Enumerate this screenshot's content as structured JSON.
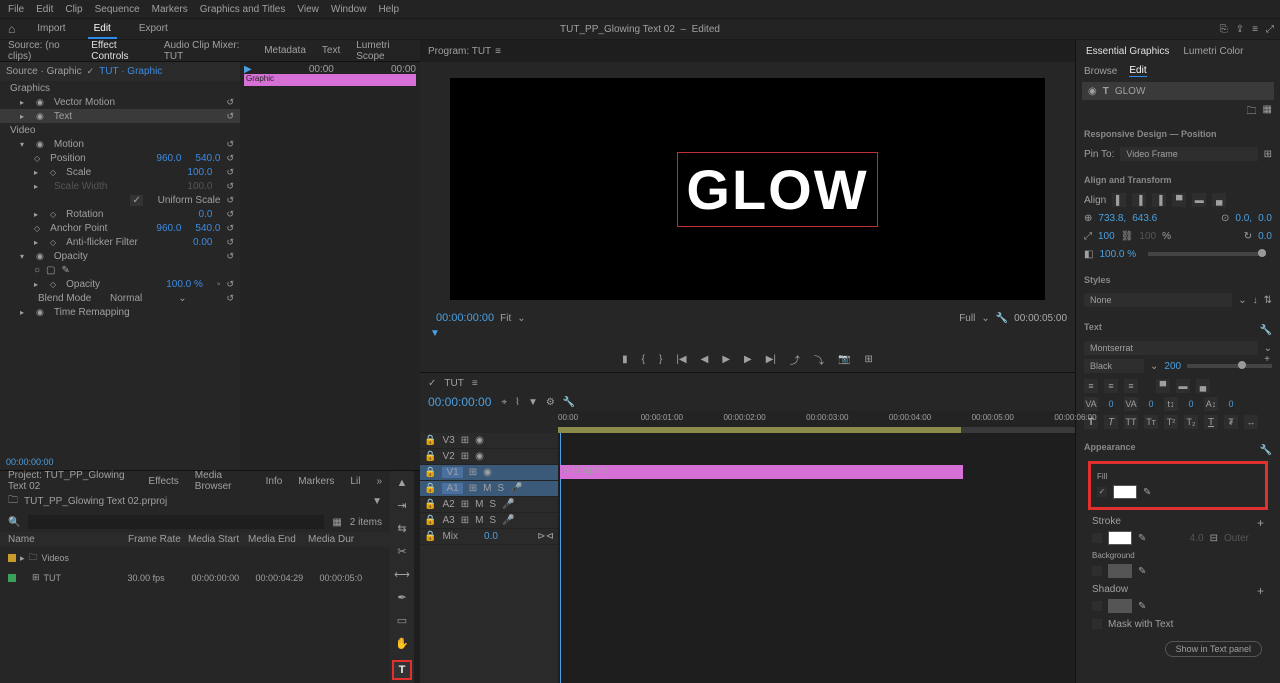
{
  "menu": [
    "File",
    "Edit",
    "Clip",
    "Sequence",
    "Markers",
    "Graphics and Titles",
    "View",
    "Window",
    "Help"
  ],
  "workspaces": [
    "Import",
    "Edit",
    "Export"
  ],
  "doc_title": "TUT_PP_Glowing Text 02",
  "doc_state": "Edited",
  "source_tabs": [
    "Source: (no clips)",
    "Effect Controls",
    "Audio Clip Mixer: TUT",
    "Metadata",
    "Text",
    "Lumetri Scope"
  ],
  "source_active": "Effect Controls",
  "ec_breadcrumb": {
    "a": "Source · Graphic",
    "b": "TUT · Graphic"
  },
  "ec_tl": {
    "start": "00:00",
    "end": "00:00"
  },
  "ec": {
    "graphics": "Graphics",
    "vector": "Vector Motion",
    "text": "Text",
    "video": "Video",
    "motion": "Motion",
    "position": "Position",
    "pos_x": "960.0",
    "pos_y": "540.0",
    "scale": "Scale",
    "scale_v": "100.0",
    "scalew": "Scale Width",
    "scalew_v": "100.0",
    "uniform": "Uniform Scale",
    "uniform_chk": "✓",
    "rotation": "Rotation",
    "rot_v": "0.0",
    "anchor": "Anchor Point",
    "anc_x": "960.0",
    "anc_y": "540.0",
    "flicker": "Anti-flicker Filter",
    "flicker_v": "0.00",
    "opacity": "Opacity",
    "opac_v": "100.0 %",
    "blend": "Blend Mode",
    "blend_v": "Normal",
    "timeremap": "Time Remapping",
    "clip_label": "Graphic"
  },
  "ec_timecode": "00:00:00:00",
  "program": {
    "tab": "Program: TUT",
    "timecode": "00:00:00:00",
    "fit": "Fit",
    "full": "Full",
    "dur": "00:00:05:00",
    "text": "GLOW"
  },
  "project": {
    "tabs": [
      "Project: TUT_PP_Glowing Text 02",
      "Effects",
      "Media Browser",
      "Info",
      "Markers",
      "Lil"
    ],
    "file": "TUT_PP_Glowing Text 02.prproj",
    "count": "2 items",
    "cols": [
      "Name",
      "Frame Rate",
      "Media Start",
      "Media End",
      "Media Dur"
    ],
    "row1": {
      "name": "Videos"
    },
    "row2": {
      "name": "TUT",
      "fr": "30.00 fps",
      "start": "00:00:00:00",
      "end": "00:00:04:29",
      "dur": "00:00:05:0"
    }
  },
  "timeline": {
    "name": "TUT",
    "tc": "00:00:00:00",
    "ticks": [
      "00:00",
      "00:00:01:00",
      "00:00:02:00",
      "00:00:03:00",
      "00:00:04:00",
      "00:00:05:00",
      "00:00:06:00"
    ],
    "tracks": {
      "v3": "V3",
      "v2": "V2",
      "v1": "V1",
      "a1": "A1",
      "a2": "A2",
      "a3": "A3",
      "mix": "Mix",
      "mix_v": "0.0"
    },
    "clip": "Graphic"
  },
  "eg": {
    "tabs": [
      "Essential Graphics",
      "Lumetri Color"
    ],
    "sub": [
      "Browse",
      "Edit"
    ],
    "layer": "GLOW",
    "rd": "Responsive Design — Position",
    "pinto": "Pin To:",
    "pinto_v": "Video Frame",
    "align": "Align and Transform",
    "align_l": "Align",
    "px": "733.8,",
    "py": "643.6",
    "ax": "0.0,",
    "ay": "0.0",
    "sw": "100",
    "sh": "100",
    "spct": "%",
    "rot": "0.0",
    "opac": "100.0 %",
    "styles": "Styles",
    "styles_v": "None",
    "text": "Text",
    "font": "Montserrat",
    "weight": "Black",
    "size": "200",
    "appearance": "Appearance",
    "fill": "Fill",
    "stroke": "Stroke",
    "stroke_v": "4.0",
    "outer": "Outer",
    "bg": "Background",
    "shadow": "Shadow",
    "mask": "Mask with Text",
    "showtext": "Show in Text panel"
  }
}
